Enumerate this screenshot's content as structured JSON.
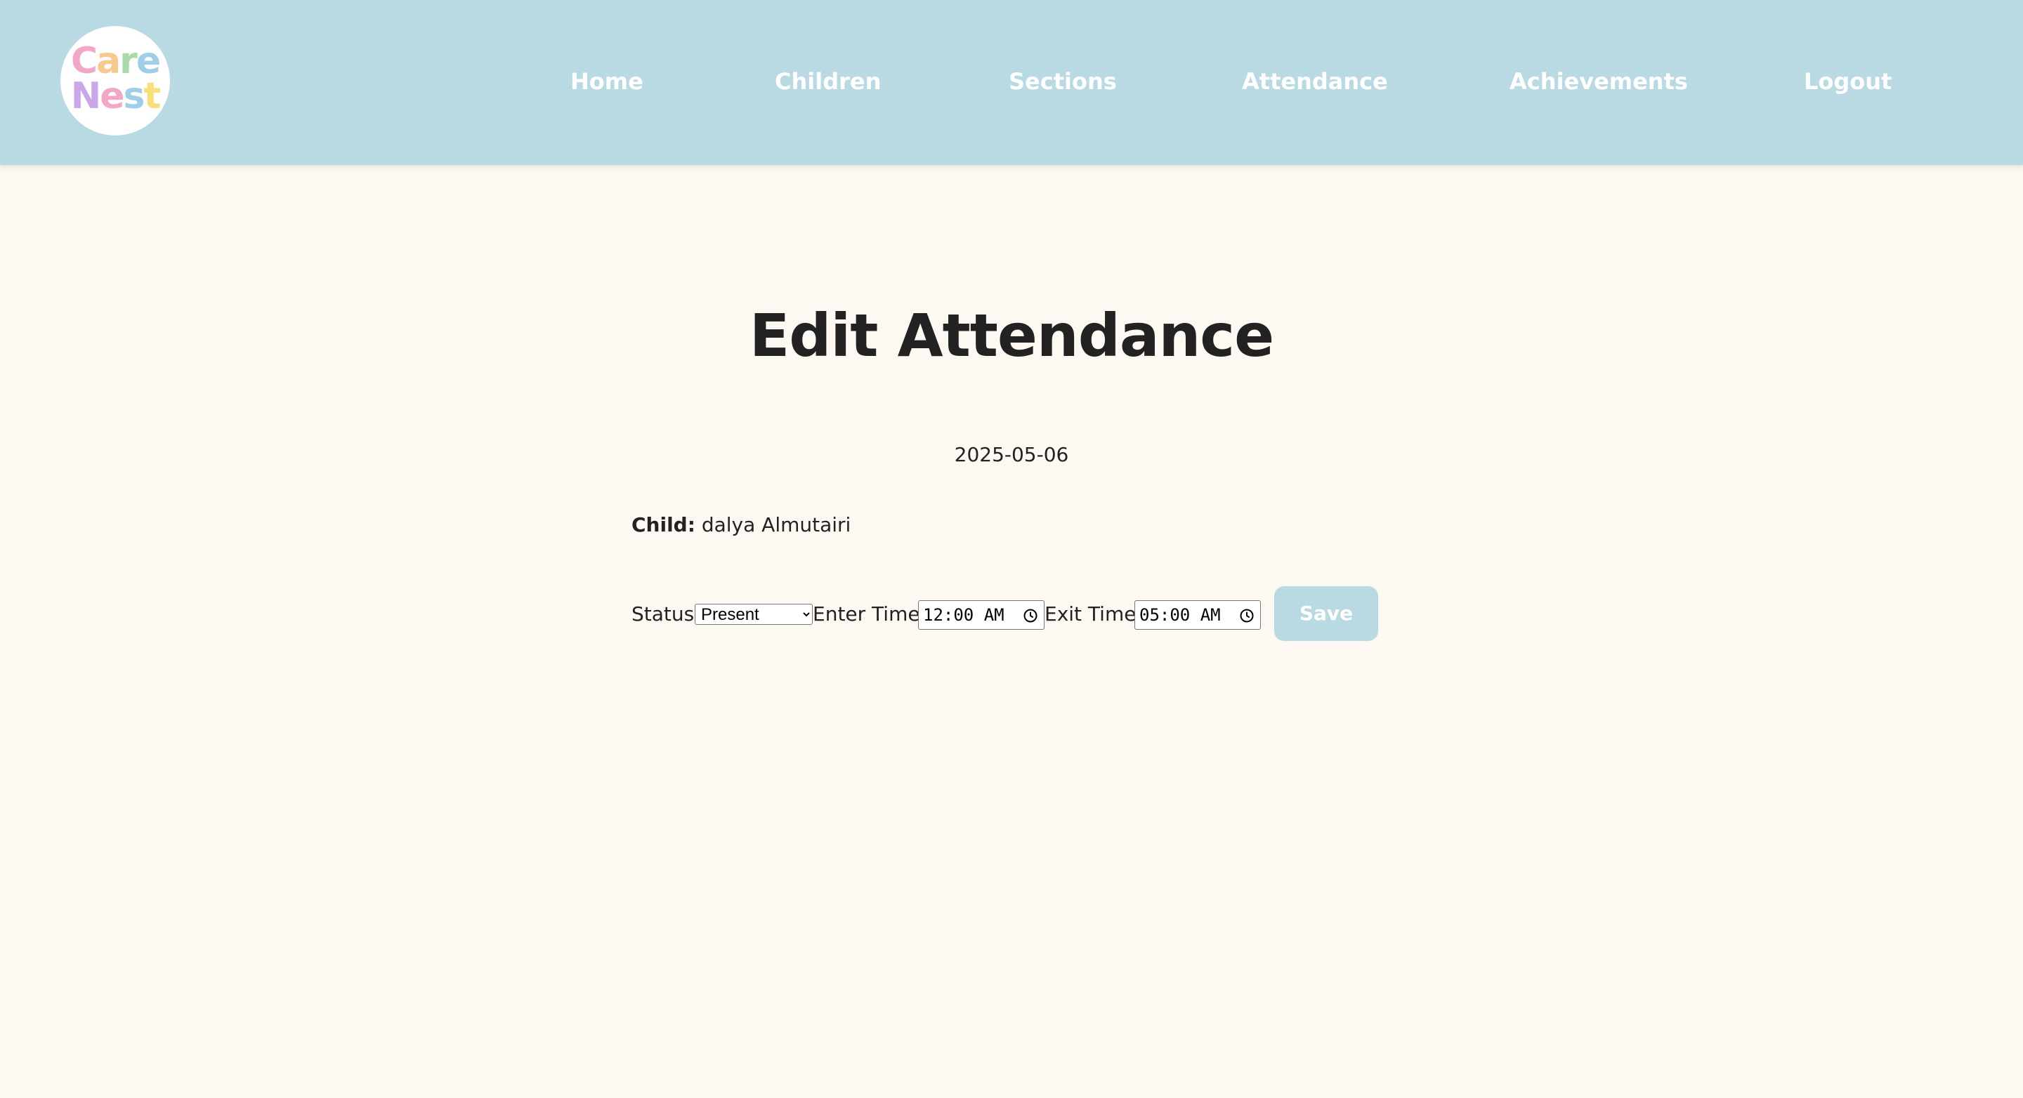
{
  "logo": {
    "line1": [
      {
        "char": "C",
        "color": "#f3a7c6"
      },
      {
        "char": "a",
        "color": "#f7c98e"
      },
      {
        "char": "r",
        "color": "#a8dba8"
      },
      {
        "char": "e",
        "color": "#9fcfe8"
      }
    ],
    "line2": [
      {
        "char": "N",
        "color": "#c9a7e8"
      },
      {
        "char": "e",
        "color": "#f3a7c6"
      },
      {
        "char": "s",
        "color": "#9fcfe8"
      },
      {
        "char": "t",
        "color": "#f7e07a"
      }
    ]
  },
  "nav": {
    "home": "Home",
    "children": "Children",
    "sections": "Sections",
    "attendance": "Attendance",
    "achievements": "Achievements",
    "logout": "Logout"
  },
  "page": {
    "title": "Edit Attendance",
    "date": "2025-05-06"
  },
  "child": {
    "label": "Child:",
    "name": "dalya Almutairi"
  },
  "form": {
    "status_label": "Status:",
    "status_options": [
      "Present"
    ],
    "status_value": "Present",
    "enter_time_label": "Enter Time:",
    "enter_time_value": "12:00 AM",
    "exit_time_label": "Exit Time:",
    "exit_time_value": "05:00 AM",
    "save_label": "Save"
  },
  "colors": {
    "navbar": "#b9dae2",
    "background": "#fdf9f2",
    "button": "#b9dae2",
    "text": "#222222"
  }
}
